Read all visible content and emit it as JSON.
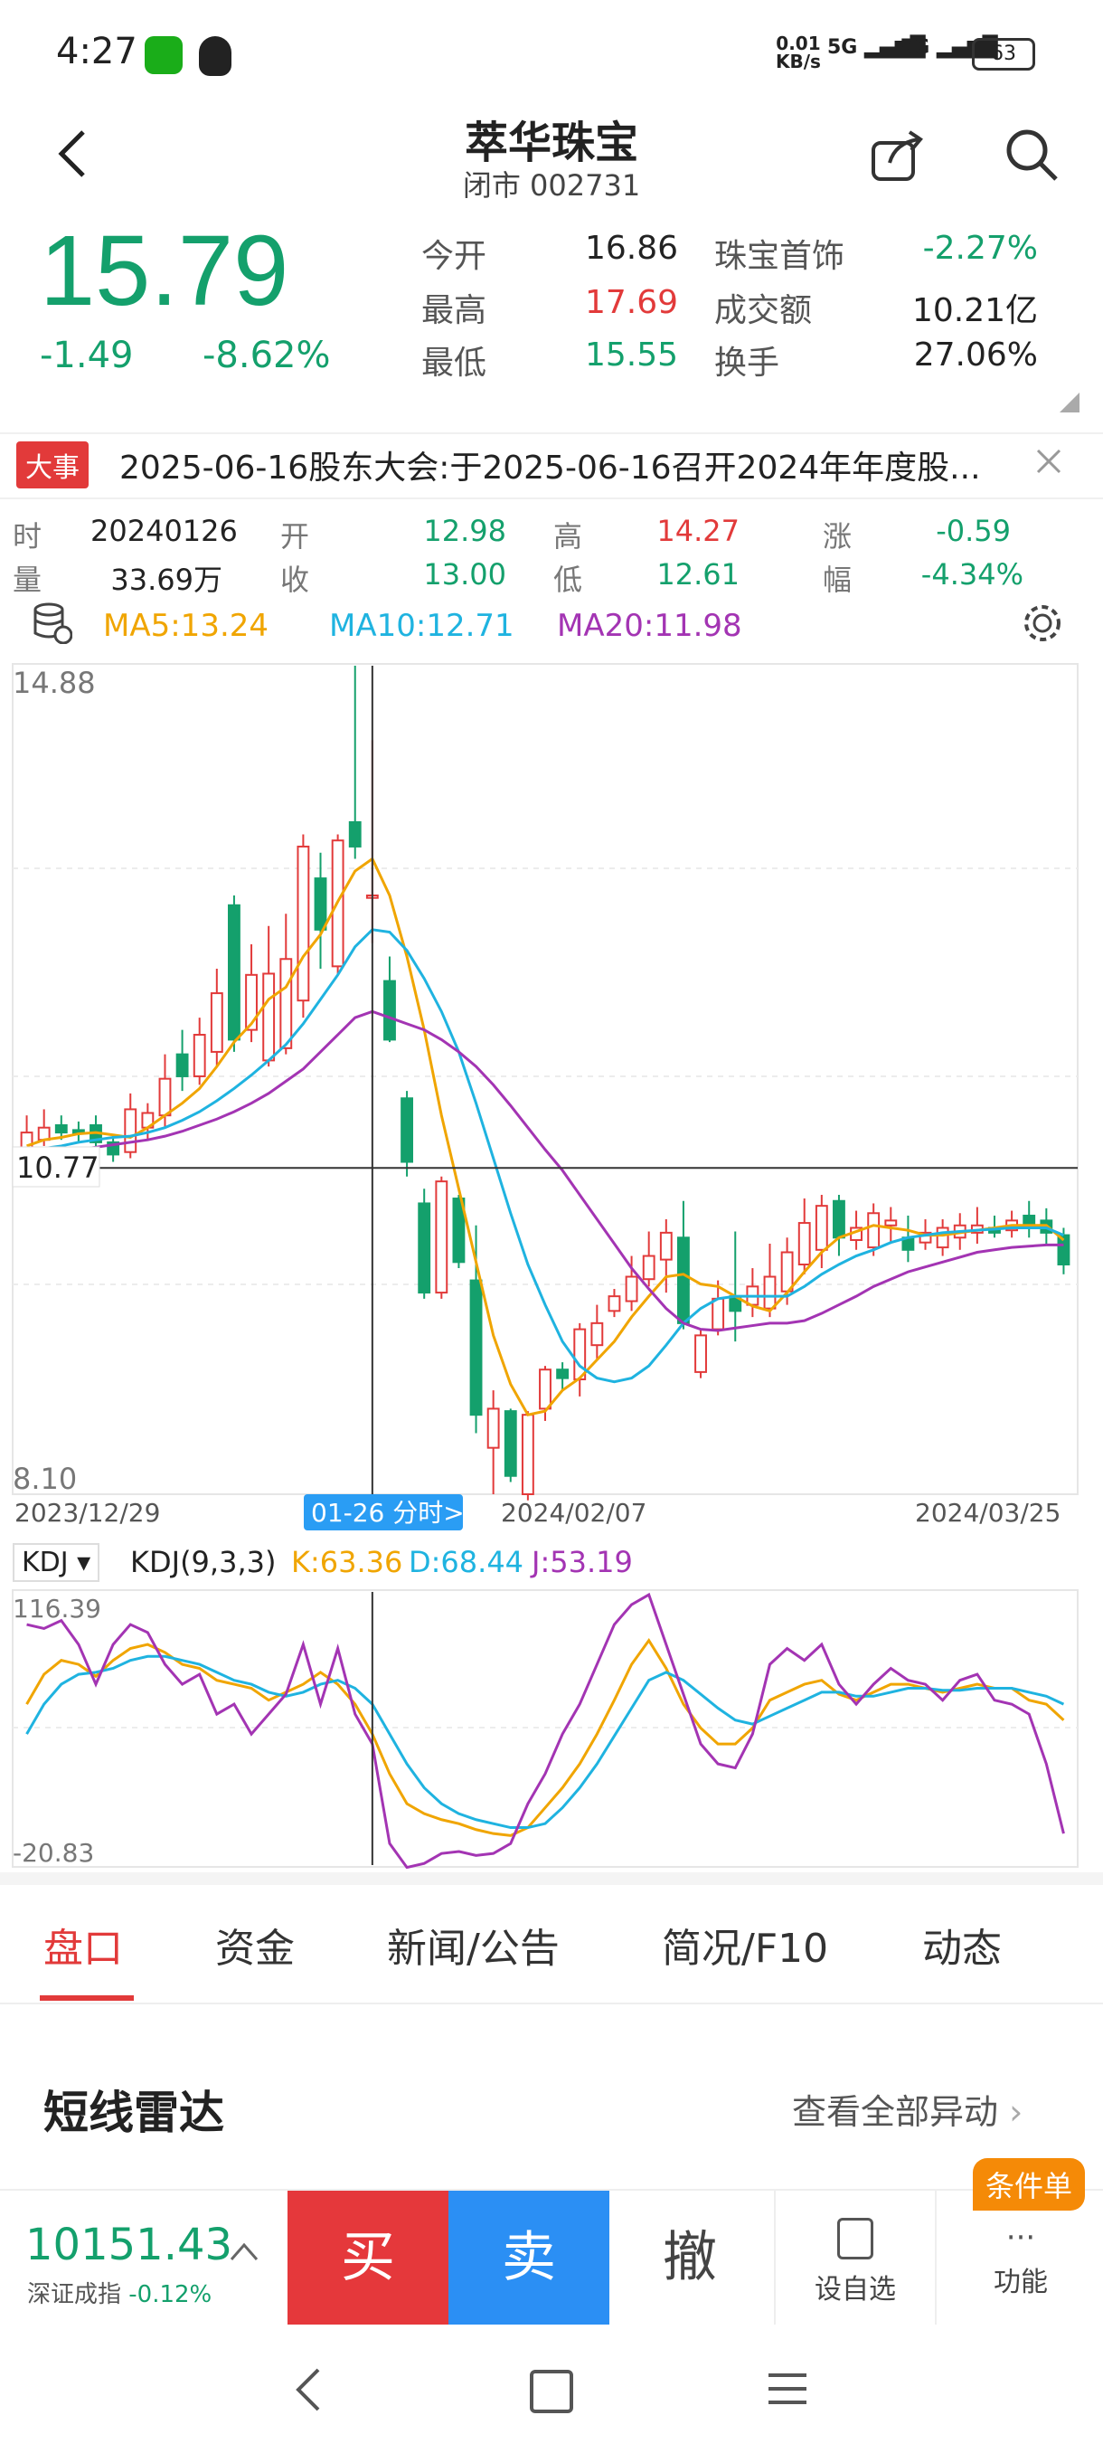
{
  "status": {
    "time": "4:27",
    "net": "0.01",
    "net_unit": "KB/s",
    "battery": "63"
  },
  "header": {
    "name": "萃华珠宝",
    "market_status": "闭市",
    "code": "002731"
  },
  "quote": {
    "price": "15.79",
    "change": "-1.49",
    "change_pct": "-8.62%",
    "open_label": "今开",
    "open": "16.86",
    "high_label": "最高",
    "high": "17.69",
    "low_label": "最低",
    "low": "15.55",
    "sector_label": "珠宝首饰",
    "sector_chg": "-2.27%",
    "amount_label": "成交额",
    "amount": "10.21亿",
    "turnover_label": "换手",
    "turnover": "27.06%"
  },
  "news": {
    "tag": "大事",
    "text": "2025-06-16股东大会:于2025-06-16召开2024年年度股..."
  },
  "bar_info": {
    "time_label": "时",
    "time": "20240126",
    "open_label": "开",
    "open": "12.98",
    "high_label": "高",
    "high": "14.27",
    "chg_label": "涨",
    "chg": "-0.59",
    "vol_label": "量",
    "vol": "33.69万",
    "close_label": "收",
    "close": "13.00",
    "low_label": "低",
    "low": "12.61",
    "pct_label": "幅",
    "pct": "-4.34%"
  },
  "ma": {
    "ma5": "MA5:13.24",
    "ma10": "MA10:12.71",
    "ma20": "MA20:11.98"
  },
  "colors": {
    "up": "#e23a3a",
    "down": "#14a06c",
    "ma5": "#f0a500",
    "ma10": "#1fb3e0",
    "ma20": "#a334b3"
  },
  "chart_data": [
    {
      "type": "candlestick",
      "y_top_label": "14.88",
      "y_bottom_label": "8.10",
      "crosshair_price": "10.77",
      "ylim": [
        8.1,
        14.88
      ],
      "x_labels": [
        "2023/12/29",
        "2024/02/07",
        "2024/03/25"
      ],
      "crosshair_label": "01-26 分时>",
      "candles": [
        {
          "o": 10.92,
          "c": 11.06,
          "h": 11.2,
          "l": 10.85
        },
        {
          "o": 11.0,
          "c": 11.1,
          "h": 11.25,
          "l": 10.95
        },
        {
          "o": 11.12,
          "c": 11.06,
          "h": 11.2,
          "l": 11.0
        },
        {
          "o": 11.08,
          "c": 11.05,
          "h": 11.15,
          "l": 10.98
        },
        {
          "o": 11.12,
          "c": 10.98,
          "h": 11.2,
          "l": 10.92
        },
        {
          "o": 10.98,
          "c": 10.88,
          "h": 11.04,
          "l": 10.82
        },
        {
          "o": 10.9,
          "c": 11.25,
          "h": 11.38,
          "l": 10.85
        },
        {
          "o": 11.1,
          "c": 11.22,
          "h": 11.3,
          "l": 11.0
        },
        {
          "o": 11.2,
          "c": 11.5,
          "h": 11.7,
          "l": 11.1
        },
        {
          "o": 11.7,
          "c": 11.52,
          "h": 11.9,
          "l": 11.4
        },
        {
          "o": 11.52,
          "c": 11.86,
          "h": 12.0,
          "l": 11.45
        },
        {
          "o": 11.72,
          "c": 12.2,
          "h": 12.4,
          "l": 11.6
        },
        {
          "o": 12.92,
          "c": 11.82,
          "h": 13.0,
          "l": 11.72
        },
        {
          "o": 11.9,
          "c": 12.35,
          "h": 12.6,
          "l": 11.8
        },
        {
          "o": 11.65,
          "c": 12.36,
          "h": 12.75,
          "l": 11.6
        },
        {
          "o": 11.75,
          "c": 12.48,
          "h": 12.85,
          "l": 11.7
        },
        {
          "o": 12.14,
          "c": 13.4,
          "h": 13.5,
          "l": 12.0
        },
        {
          "o": 13.14,
          "c": 12.72,
          "h": 13.35,
          "l": 12.4
        },
        {
          "o": 12.42,
          "c": 13.45,
          "h": 13.5,
          "l": 12.35
        },
        {
          "o": 13.6,
          "c": 13.4,
          "h": 14.88,
          "l": 13.3
        },
        {
          "o": 12.98,
          "c": 13.0,
          "h": 14.27,
          "l": 12.61
        },
        {
          "o": 12.3,
          "c": 11.82,
          "h": 12.5,
          "l": 11.8
        },
        {
          "o": 11.34,
          "c": 10.82,
          "h": 11.4,
          "l": 10.7
        },
        {
          "o": 10.48,
          "c": 9.75,
          "h": 10.6,
          "l": 9.7
        },
        {
          "o": 9.75,
          "c": 10.66,
          "h": 10.7,
          "l": 9.7
        },
        {
          "o": 10.52,
          "c": 10.0,
          "h": 10.55,
          "l": 9.95
        },
        {
          "o": 9.85,
          "c": 8.75,
          "h": 10.3,
          "l": 8.6
        },
        {
          "o": 8.48,
          "c": 8.8,
          "h": 8.95,
          "l": 8.1
        },
        {
          "o": 8.78,
          "c": 8.25,
          "h": 8.8,
          "l": 8.2
        },
        {
          "o": 8.1,
          "c": 8.75,
          "h": 8.78,
          "l": 8.05
        },
        {
          "o": 8.8,
          "c": 9.12,
          "h": 9.15,
          "l": 8.7
        },
        {
          "o": 9.12,
          "c": 9.05,
          "h": 9.18,
          "l": 8.95
        },
        {
          "o": 9.04,
          "c": 9.45,
          "h": 9.5,
          "l": 8.9
        },
        {
          "o": 9.32,
          "c": 9.5,
          "h": 9.65,
          "l": 9.2
        },
        {
          "o": 9.6,
          "c": 9.72,
          "h": 9.78,
          "l": 9.55
        },
        {
          "o": 9.68,
          "c": 9.88,
          "h": 10.05,
          "l": 9.6
        },
        {
          "o": 9.86,
          "c": 10.05,
          "h": 10.25,
          "l": 9.8
        },
        {
          "o": 10.02,
          "c": 10.24,
          "h": 10.35,
          "l": 9.75
        },
        {
          "o": 10.2,
          "c": 9.5,
          "h": 10.5,
          "l": 9.45
        },
        {
          "o": 9.1,
          "c": 9.4,
          "h": 9.45,
          "l": 9.05
        },
        {
          "o": 9.45,
          "c": 9.7,
          "h": 9.85,
          "l": 9.4
        },
        {
          "o": 9.72,
          "c": 9.6,
          "h": 10.25,
          "l": 9.35
        },
        {
          "o": 9.65,
          "c": 9.8,
          "h": 9.95,
          "l": 9.55
        },
        {
          "o": 9.62,
          "c": 9.88,
          "h": 10.15,
          "l": 9.55
        },
        {
          "o": 9.76,
          "c": 10.08,
          "h": 10.2,
          "l": 9.65
        },
        {
          "o": 9.98,
          "c": 10.32,
          "h": 10.52,
          "l": 9.9
        },
        {
          "o": 10.1,
          "c": 10.46,
          "h": 10.55,
          "l": 9.95
        },
        {
          "o": 10.5,
          "c": 10.2,
          "h": 10.55,
          "l": 10.05
        },
        {
          "o": 10.18,
          "c": 10.28,
          "h": 10.42,
          "l": 10.1
        },
        {
          "o": 10.12,
          "c": 10.4,
          "h": 10.48,
          "l": 10.05
        },
        {
          "o": 10.3,
          "c": 10.34,
          "h": 10.45,
          "l": 10.15
        },
        {
          "o": 10.2,
          "c": 10.1,
          "h": 10.38,
          "l": 10.0
        },
        {
          "o": 10.16,
          "c": 10.24,
          "h": 10.35,
          "l": 10.1
        },
        {
          "o": 10.12,
          "c": 10.28,
          "h": 10.35,
          "l": 10.05
        },
        {
          "o": 10.2,
          "c": 10.3,
          "h": 10.4,
          "l": 10.1
        },
        {
          "o": 10.24,
          "c": 10.3,
          "h": 10.45,
          "l": 10.15
        },
        {
          "o": 10.28,
          "c": 10.24,
          "h": 10.38,
          "l": 10.2
        },
        {
          "o": 10.26,
          "c": 10.34,
          "h": 10.42,
          "l": 10.2
        },
        {
          "o": 10.38,
          "c": 10.28,
          "h": 10.5,
          "l": 10.2
        },
        {
          "o": 10.34,
          "c": 10.24,
          "h": 10.44,
          "l": 10.15
        },
        {
          "o": 10.22,
          "c": 9.98,
          "h": 10.28,
          "l": 9.9
        }
      ],
      "ma5": [
        10.95,
        11.0,
        11.02,
        11.05,
        11.06,
        11.04,
        11.02,
        11.1,
        11.2,
        11.3,
        11.42,
        11.6,
        11.8,
        11.95,
        12.15,
        12.25,
        12.5,
        12.68,
        12.95,
        13.2,
        13.3,
        13.0,
        12.5,
        11.9,
        11.2,
        10.6,
        10.0,
        9.4,
        9.0,
        8.75,
        8.78,
        8.95,
        9.05,
        9.2,
        9.35,
        9.55,
        9.72,
        9.88,
        9.9,
        9.82,
        9.8,
        9.72,
        9.64,
        9.6,
        9.75,
        9.92,
        10.08,
        10.2,
        10.25,
        10.3,
        10.28,
        10.26,
        10.22,
        10.22,
        10.24,
        10.26,
        10.28,
        10.3,
        10.3,
        10.3,
        10.18
      ],
      "ma10": [
        10.9,
        10.93,
        10.95,
        10.98,
        11.0,
        11.02,
        11.03,
        11.06,
        11.1,
        11.16,
        11.23,
        11.32,
        11.42,
        11.53,
        11.65,
        11.78,
        11.95,
        12.15,
        12.35,
        12.58,
        12.72,
        12.7,
        12.55,
        12.32,
        12.05,
        11.72,
        11.3,
        10.85,
        10.4,
        9.98,
        9.65,
        9.35,
        9.15,
        9.05,
        9.02,
        9.05,
        9.15,
        9.32,
        9.5,
        9.62,
        9.7,
        9.72,
        9.72,
        9.72,
        9.72,
        9.8,
        9.9,
        9.98,
        10.05,
        10.1,
        10.16,
        10.2,
        10.22,
        10.24,
        10.25,
        10.26,
        10.27,
        10.28,
        10.28,
        10.28,
        10.22
      ],
      "ma20": [
        10.88,
        10.89,
        10.9,
        10.92,
        10.94,
        10.96,
        10.98,
        11.0,
        11.03,
        11.07,
        11.12,
        11.17,
        11.23,
        11.3,
        11.38,
        11.48,
        11.58,
        11.72,
        11.86,
        12.0,
        12.05,
        12.0,
        11.95,
        11.9,
        11.82,
        11.72,
        11.6,
        11.45,
        11.28,
        11.1,
        10.92,
        10.75,
        10.55,
        10.35,
        10.15,
        9.95,
        9.78,
        9.62,
        9.5,
        9.45,
        9.44,
        9.46,
        9.48,
        9.5,
        9.5,
        9.52,
        9.58,
        9.65,
        9.72,
        9.8,
        9.86,
        9.92,
        9.96,
        10.0,
        10.04,
        10.08,
        10.1,
        10.12,
        10.13,
        10.14,
        10.14
      ]
    },
    {
      "type": "line",
      "title": "KDJ(9,3,3)",
      "selector": "KDJ",
      "k_label": "K:63.36",
      "d_label": "D:68.44",
      "j_label": "J:53.19",
      "y_top_label": "116.39",
      "y_bottom_label": "-20.83",
      "ylim": [
        -20.83,
        116.39
      ],
      "series": [
        {
          "name": "K",
          "values": [
            60,
            75,
            82,
            80,
            74,
            82,
            88,
            90,
            86,
            80,
            78,
            72,
            70,
            68,
            62,
            66,
            70,
            76,
            70,
            60,
            45,
            25,
            10,
            5,
            2,
            0,
            -3,
            -5,
            -6,
            -2,
            8,
            18,
            30,
            45,
            62,
            80,
            92,
            78,
            60,
            48,
            40,
            40,
            48,
            62,
            66,
            70,
            72,
            65,
            62,
            66,
            70,
            70,
            68,
            66,
            68,
            70,
            68,
            68,
            62,
            60,
            52
          ]
        },
        {
          "name": "D",
          "values": [
            45,
            60,
            70,
            75,
            76,
            78,
            82,
            84,
            84,
            82,
            80,
            76,
            72,
            70,
            66,
            64,
            66,
            70,
            72,
            68,
            60,
            45,
            30,
            18,
            10,
            5,
            2,
            0,
            -2,
            -2,
            0,
            8,
            18,
            30,
            44,
            58,
            72,
            76,
            72,
            65,
            58,
            52,
            50,
            54,
            58,
            62,
            66,
            66,
            64,
            64,
            66,
            68,
            68,
            67,
            67,
            68,
            68,
            68,
            66,
            64,
            60
          ]
        },
        {
          "name": "J",
          "values": [
            100,
            98,
            102,
            90,
            70,
            90,
            100,
            96,
            80,
            70,
            75,
            55,
            60,
            45,
            55,
            65,
            90,
            60,
            88,
            55,
            40,
            -10,
            -22,
            -20,
            -15,
            -14,
            -16,
            -15,
            -10,
            10,
            25,
            45,
            60,
            80,
            100,
            110,
            115,
            90,
            65,
            40,
            30,
            28,
            45,
            80,
            88,
            82,
            90,
            70,
            60,
            70,
            78,
            72,
            70,
            62,
            72,
            75,
            62,
            60,
            55,
            30,
            -5
          ]
        }
      ]
    }
  ],
  "tabs": [
    "盘口",
    "资金",
    "新闻/公告",
    "简况/F10",
    "动态"
  ],
  "radar": {
    "title": "短线雷达",
    "link": "查看全部异动"
  },
  "bottom": {
    "index_value": "10151.43",
    "index_name": "深证成指",
    "index_chg": "-0.12%",
    "buy": "买",
    "sell": "卖",
    "cancel": "撤",
    "watch": "设自选",
    "more": "功能",
    "badge": "条件单"
  }
}
